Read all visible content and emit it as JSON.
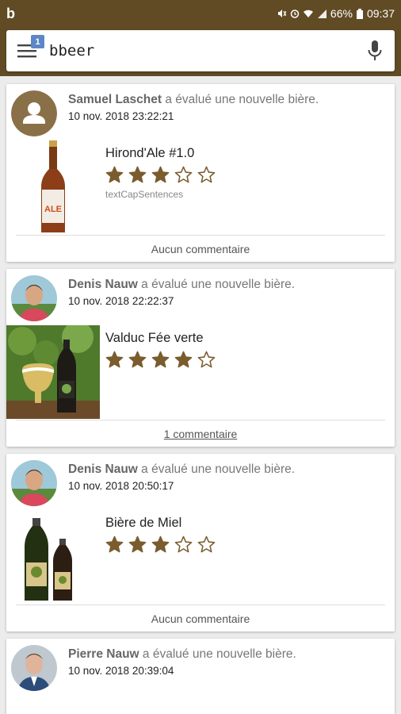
{
  "status": {
    "app_letter": "b",
    "battery": "66%",
    "time": "09:37"
  },
  "search": {
    "value": "bbeer",
    "badge": "1"
  },
  "colors": {
    "brand": "#614b25",
    "star": "#7a5c2e",
    "badge": "#5c86c8"
  },
  "feed": [
    {
      "user": "Samuel Laschet",
      "action": " a évalué une nouvelle bière.",
      "date": "10 nov. 2018 23:22:21",
      "beer": "Hirond'Ale #1.0",
      "rating": 3,
      "hint": "textCapSentences",
      "comments": "Aucun commentaire",
      "avatar": "default-user-icon"
    },
    {
      "user": "Denis Nauw",
      "action": " a évalué une nouvelle bière.",
      "date": "10 nov. 2018 22:22:37",
      "beer": "Valduc Fée verte",
      "rating": 4,
      "comments": "1 commentaire",
      "avatar": "photo"
    },
    {
      "user": "Denis Nauw",
      "action": " a évalué une nouvelle bière.",
      "date": "10 nov. 2018 20:50:17",
      "beer": "Bière de Miel",
      "rating": 3,
      "comments": "Aucun commentaire",
      "avatar": "photo"
    },
    {
      "user": "Pierre Nauw",
      "action": " a évalué une nouvelle bière.",
      "date": "10 nov. 2018 20:39:04",
      "avatar": "photo"
    }
  ]
}
